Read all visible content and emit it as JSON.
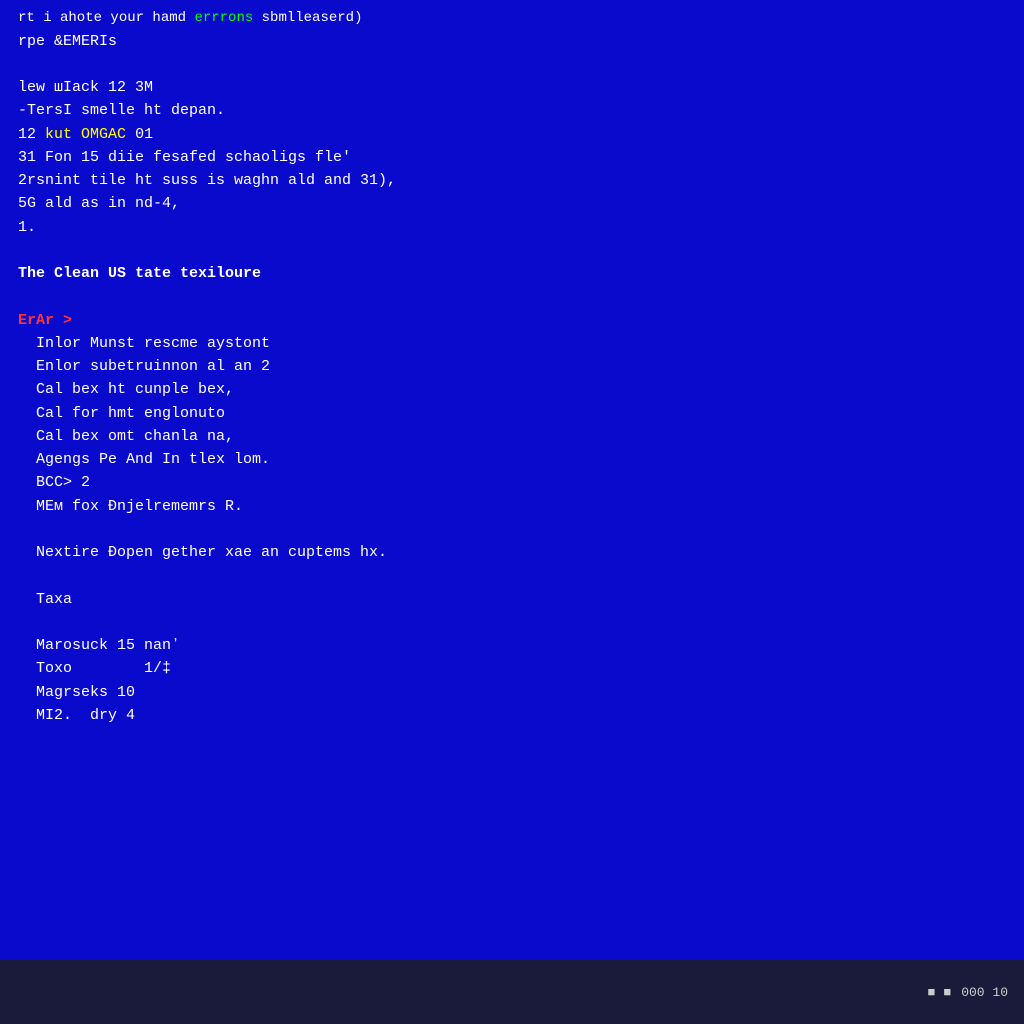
{
  "screen": {
    "background": "#0a0acd",
    "lines": [
      {
        "id": "line1",
        "text": "rt i ahote your hamd ",
        "color": "white",
        "inline": [
          {
            "text": "errrons",
            "color": "green"
          },
          {
            "text": " sbmlleaserd)",
            "color": "white"
          }
        ]
      },
      {
        "id": "line2",
        "text": "rpe &EMERIs",
        "color": "white"
      },
      {
        "id": "blank1",
        "type": "blank"
      },
      {
        "id": "line3",
        "text": "lew шIack 12 3M",
        "color": "white"
      },
      {
        "id": "line4",
        "text": "-TersI smelle ht depan.",
        "color": "white"
      },
      {
        "id": "line5",
        "text": "12 ",
        "color": "white",
        "inline": [
          {
            "text": "kut",
            "color": "yellow"
          },
          {
            "text": " ",
            "color": "white"
          },
          {
            "text": "OMGAC",
            "color": "yellow"
          },
          {
            "text": " 01",
            "color": "white"
          }
        ]
      },
      {
        "id": "line6",
        "text": "31 Fon 15 diie fesafed schaoligs fle'",
        "color": "white"
      },
      {
        "id": "line7",
        "text": "2rsnint tile ht suss is waghn ald and 31),",
        "color": "white"
      },
      {
        "id": "line8",
        "text": "5G ald as in nd-4,",
        "color": "white"
      },
      {
        "id": "line9",
        "text": "1.",
        "color": "white"
      },
      {
        "id": "blank2",
        "type": "blank"
      },
      {
        "id": "line10",
        "text": "The Clean US tate texiloure",
        "color": "white"
      },
      {
        "id": "blank3",
        "type": "blank"
      },
      {
        "id": "line11_prompt",
        "text": "ErAr >",
        "color": "red"
      },
      {
        "id": "line12",
        "text": "  Inlor Munst rescme aystont",
        "color": "white"
      },
      {
        "id": "line13",
        "text": "  Enlor subetruinnon al an 2",
        "color": "white"
      },
      {
        "id": "line14",
        "text": "  Cal bex ht cunple bex,",
        "color": "white"
      },
      {
        "id": "line15",
        "text": "  Cal for hmt englonuto",
        "color": "white"
      },
      {
        "id": "line16",
        "text": "  Cal bex omt chanla na,",
        "color": "white"
      },
      {
        "id": "line17",
        "text": "  Agengs Pe And In tlex lom.",
        "color": "white"
      },
      {
        "id": "line18",
        "text": "  BCC> 2",
        "color": "white"
      },
      {
        "id": "line19",
        "text": "  MEC fox Đnjelrememrs R.",
        "color": "white"
      },
      {
        "id": "blank4",
        "type": "blank"
      },
      {
        "id": "line20",
        "text": "  Nextire Đopen gether xae an cuptems hx.",
        "color": "white"
      },
      {
        "id": "blank5",
        "type": "blank"
      },
      {
        "id": "line21",
        "text": "  Taxa",
        "color": "white"
      },
      {
        "id": "blank6",
        "type": "blank"
      },
      {
        "id": "line22",
        "text": "  Marosuck 15 nanʼ",
        "color": "white"
      },
      {
        "id": "line23",
        "text": "  Toxo        1/‡",
        "color": "white"
      },
      {
        "id": "line24",
        "text": "  Magrseks 10",
        "color": "white"
      },
      {
        "id": "line25",
        "text": "  MI2.  dry 4",
        "color": "white"
      }
    ]
  },
  "taskbar": {
    "time": "000 10",
    "icons": [
      "■",
      "■"
    ]
  }
}
